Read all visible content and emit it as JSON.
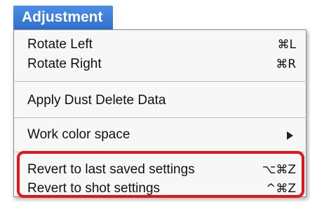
{
  "menu": {
    "title": "Adjustment",
    "items": [
      {
        "label": "Rotate Left",
        "shortcut": "⌘L"
      },
      {
        "label": "Rotate Right",
        "shortcut": "⌘R"
      },
      {
        "label": "Apply Dust Delete Data",
        "shortcut": ""
      },
      {
        "label": "Work color space",
        "submenu": true
      },
      {
        "label": "Revert to last saved settings",
        "shortcut": "⌥⌘Z"
      },
      {
        "label": "Revert to shot settings",
        "shortcut": "^⌘Z"
      }
    ]
  },
  "colors": {
    "title_bg": "#3a7bde",
    "highlight_border": "#e3141a",
    "menu_bg": "#f7f7f7"
  },
  "icons": {
    "submenu": "submenu-arrow-icon"
  }
}
